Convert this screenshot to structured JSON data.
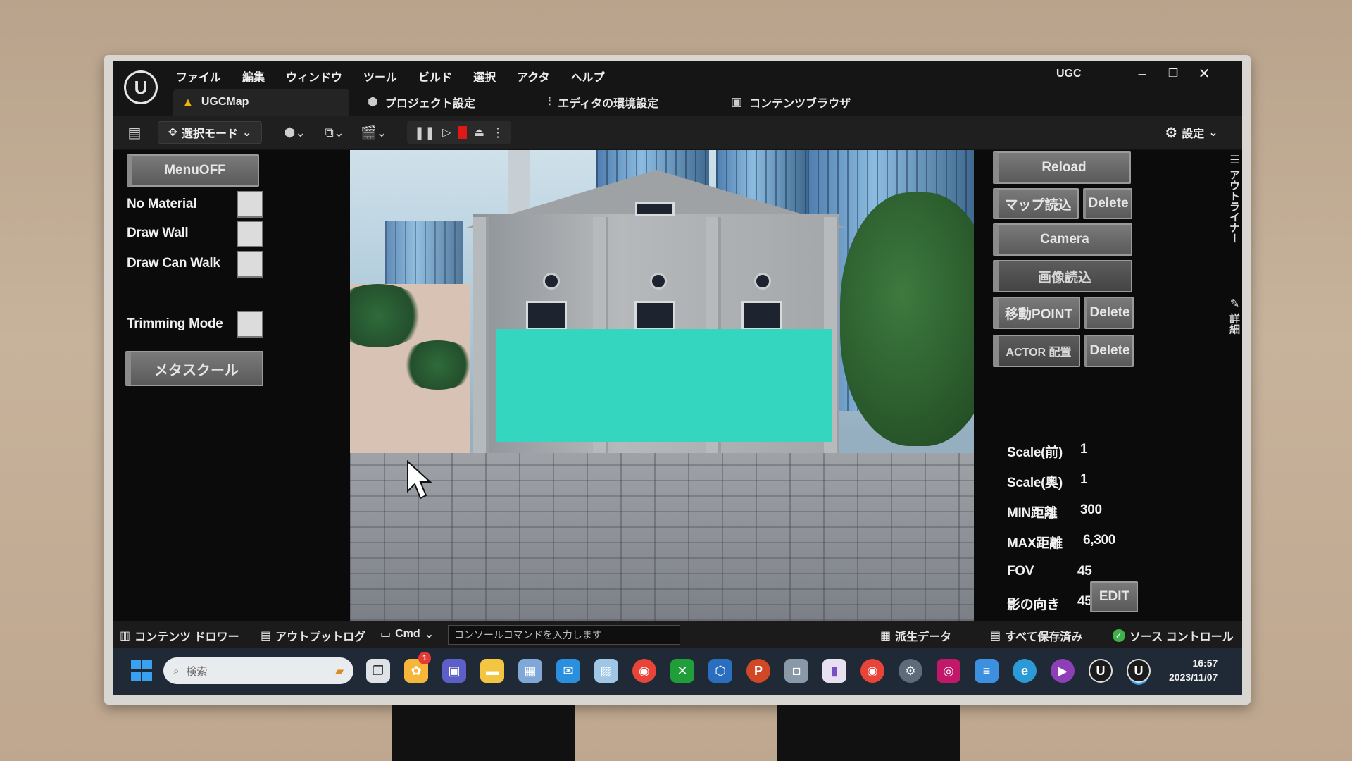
{
  "menu": [
    "ファイル",
    "編集",
    "ウィンドウ",
    "ツール",
    "ビルド",
    "選択",
    "アクタ",
    "ヘルプ"
  ],
  "app_title": "UGC",
  "window_controls": {
    "minimize": "–",
    "restore": "❐",
    "close": "✕"
  },
  "tabs": {
    "map": "UGCMap",
    "project_settings": "プロジェクト設定",
    "editor_prefs": "エディタの環境設定",
    "content_browser": "コンテンツブラウザ"
  },
  "toolbar": {
    "select_mode": "選択モード",
    "settings": "設定"
  },
  "left_panel": {
    "menu_off": "MenuOFF",
    "options": [
      "No Material",
      "Draw Wall",
      "Draw Can Walk"
    ],
    "trimming_mode": "Trimming Mode",
    "metaschool": "メタスクール"
  },
  "right_panel": {
    "reload": "Reload",
    "map_load": "マップ読込",
    "delete": "Delete",
    "camera": "Camera",
    "image_load": "画像読込",
    "move_point": "移動POINT",
    "actor_place": "ACTOR 配置",
    "edit": "EDIT",
    "outliner": "アウトライナー",
    "details": "詳細"
  },
  "stats": {
    "scale_front": {
      "label": "Scale(前)",
      "value": "1"
    },
    "scale_back": {
      "label": "Scale(奥)",
      "value": "1"
    },
    "min_dist": {
      "label": "MIN距離",
      "value": "300"
    },
    "max_dist": {
      "label": "MAX距離",
      "value": "6,300"
    },
    "fov": {
      "label": "FOV",
      "value": "45"
    },
    "shadow_dir": {
      "label": "影の向き",
      "value": "45"
    }
  },
  "bottom_bar": {
    "content_drawer": "コンテンツ ドロワー",
    "output_log": "アウトプットログ",
    "cmd": "Cmd",
    "console_placeholder": "コンソールコマンドを入力します",
    "derived_data": "派生データ",
    "all_saved": "すべて保存済み",
    "source_control": "ソース コントロール"
  },
  "taskbar": {
    "search_placeholder": "検索",
    "time": "16:57",
    "date": "2023/11/07",
    "badge_count": "1"
  },
  "colors": {
    "accent": "#3aa0f0",
    "stop_red": "#e01818",
    "warning": "#f0b400",
    "redaction": "#34d6bf",
    "ok_green": "#3fb24a"
  }
}
